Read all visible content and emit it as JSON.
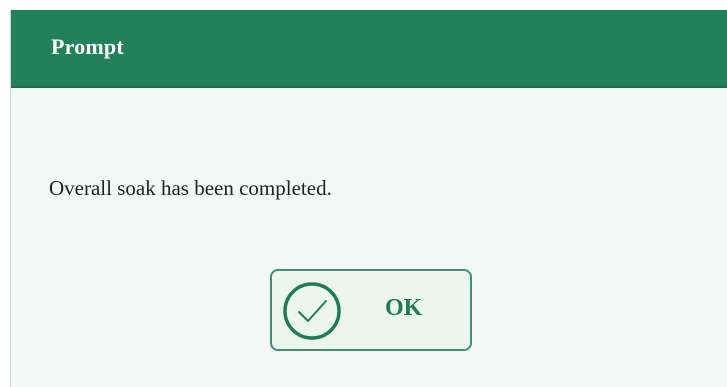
{
  "dialog": {
    "title": "Prompt",
    "message": "Overall soak has been completed.",
    "ok_button": {
      "label": "OK",
      "icon": "check-circle-icon"
    }
  },
  "colors": {
    "titlebar": "#22805a",
    "accent": "#1f7b56",
    "dialog_background": "#f1f8f6"
  }
}
